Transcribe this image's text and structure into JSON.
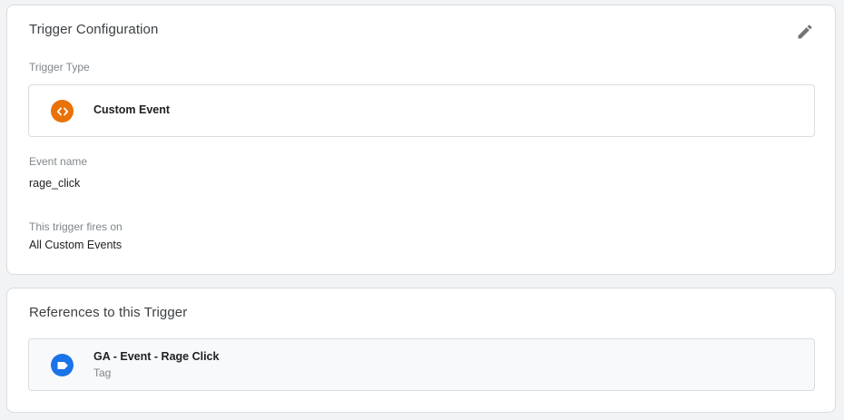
{
  "trigger_config": {
    "title": "Trigger Configuration",
    "edit_icon": "pencil-icon",
    "trigger_type_label": "Trigger Type",
    "trigger_type": {
      "name": "Custom Event",
      "icon": "code-brackets-icon",
      "icon_color": "#e8710a"
    },
    "event_name_label": "Event name",
    "event_name_value": "rage_click",
    "fires_on_label": "This trigger fires on",
    "fires_on_value": "All Custom Events"
  },
  "references": {
    "title": "References to this Trigger",
    "items": [
      {
        "name": "GA - Event - Rage Click",
        "type": "Tag",
        "icon": "tag-icon",
        "icon_color": "#1a73e8"
      }
    ]
  }
}
